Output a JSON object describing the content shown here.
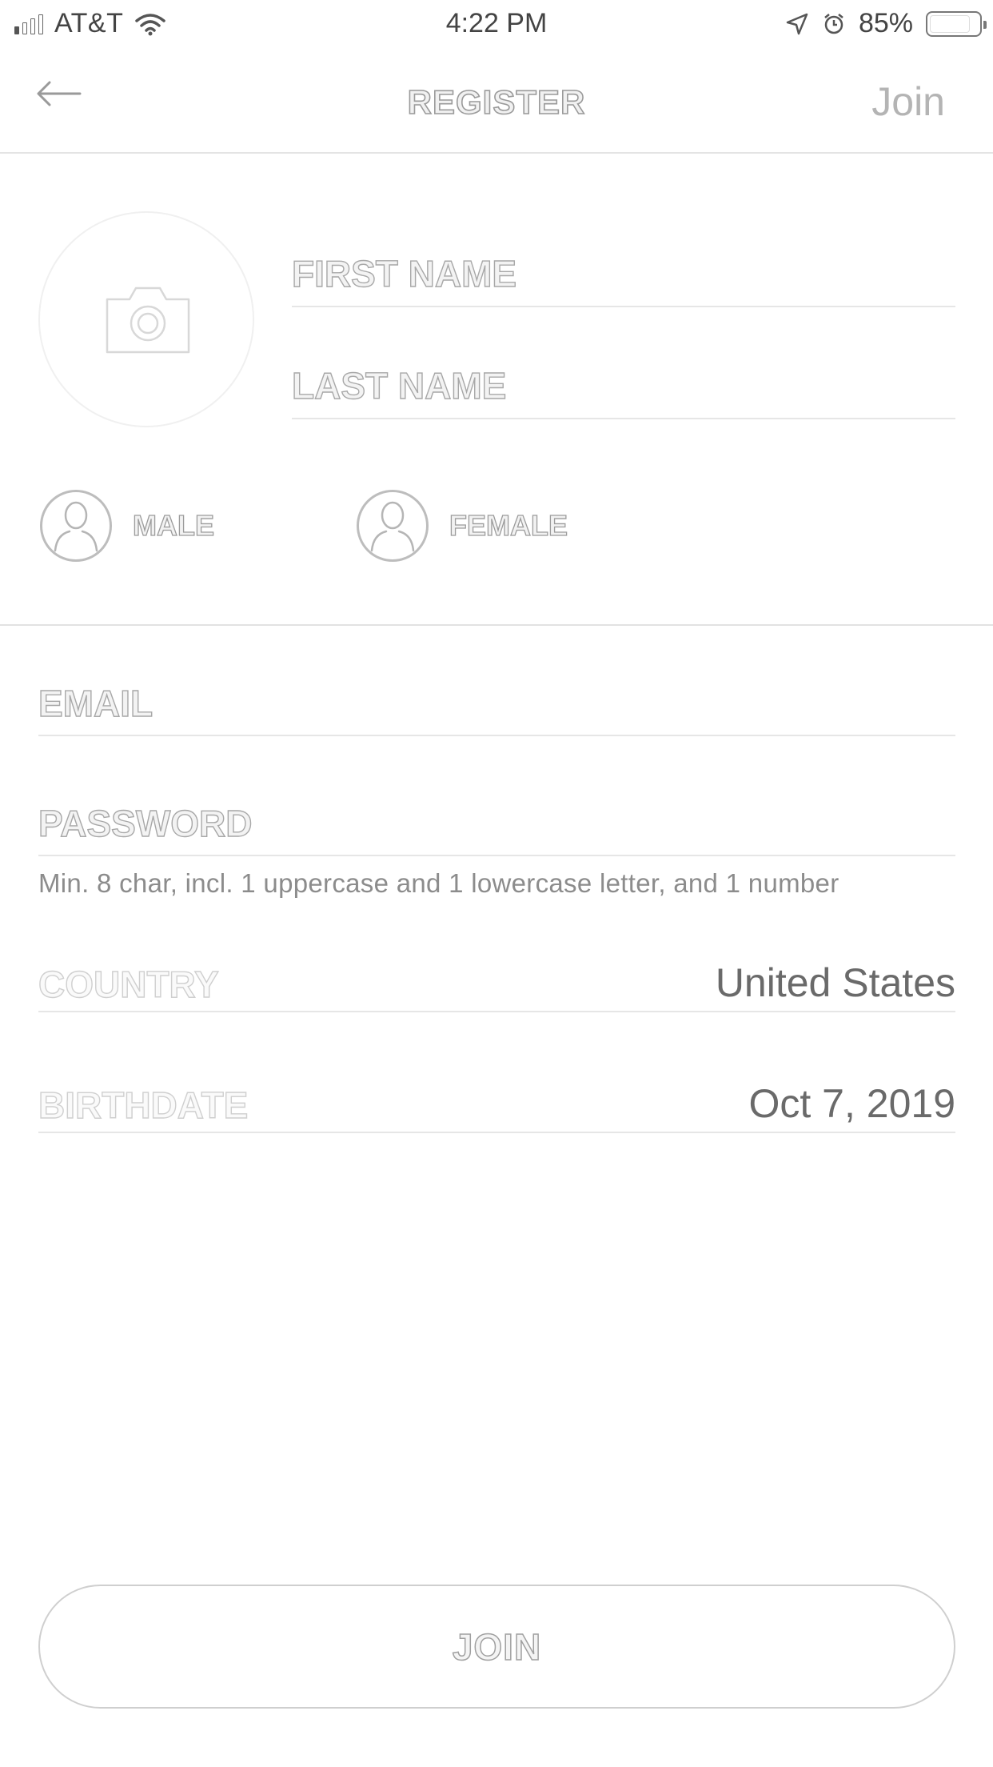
{
  "status_bar": {
    "carrier": "AT&T",
    "time": "4:22 PM",
    "battery": "85%",
    "battery_level": 0.85,
    "signal_bars_on": 1,
    "signal_bars_total": 4
  },
  "nav": {
    "title": "REGISTER",
    "join_label": "Join",
    "back_icon": "arrow-left-icon"
  },
  "profile": {
    "photo_icon": "camera-icon",
    "first_name_placeholder": "FIRST NAME",
    "last_name_placeholder": "LAST NAME",
    "male_label": "MALE",
    "female_label": "FEMALE",
    "gender_icon": "person-icon"
  },
  "form": {
    "email_placeholder": "EMAIL",
    "password_placeholder": "PASSWORD",
    "password_hint": "Min. 8 char, incl. 1 uppercase and 1 lowercase letter, and 1 number",
    "country_label": "COUNTRY",
    "country_value": "United States",
    "birthdate_label": "BIRTHDATE",
    "birthdate_value": "Oct 7, 2019"
  },
  "join_button": {
    "label": "JOIN"
  },
  "colors": {
    "text_primary": "#6a6a6a",
    "outline_text": "#a8a8a8",
    "divider": "#e6e6e6",
    "background": "#ffffff"
  }
}
